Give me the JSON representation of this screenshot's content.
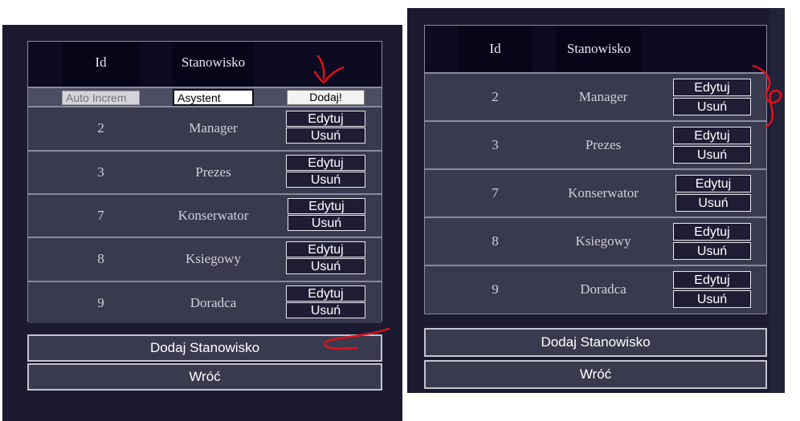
{
  "header": {
    "col_id": "Id",
    "col_name": "Stanowisko"
  },
  "add_row": {
    "id_placeholder": "Auto Increm",
    "name_value": "Asystent",
    "submit_label": "Dodaj!"
  },
  "rows": [
    {
      "id": "2",
      "name": "Manager"
    },
    {
      "id": "3",
      "name": "Prezes"
    },
    {
      "id": "7",
      "name": "Konserwator"
    },
    {
      "id": "8",
      "name": "Ksiegowy"
    },
    {
      "id": "9",
      "name": "Doradca"
    }
  ],
  "row_actions": {
    "edit_label": "Edytuj",
    "delete_label": "Usuń"
  },
  "footer": {
    "add_label": "Dodaj Stanowisko",
    "back_label": "Wróć"
  },
  "colors": {
    "panel": "#1b1a30",
    "row": "#3a3a4e",
    "header": "#0c0b22",
    "annotation": "#e0101a"
  }
}
